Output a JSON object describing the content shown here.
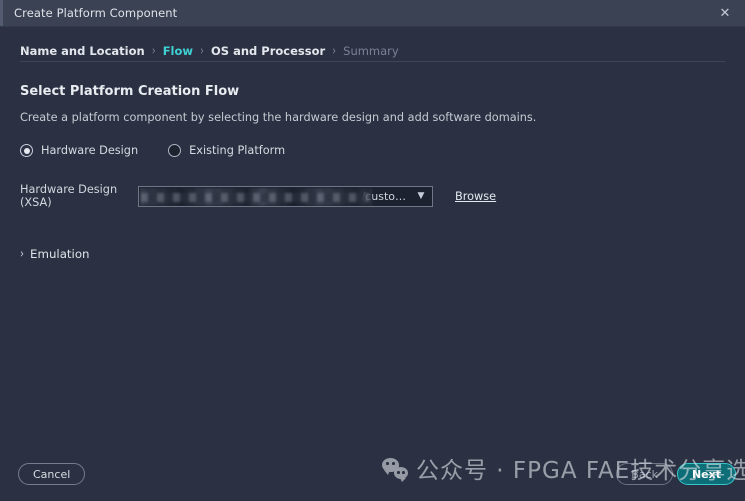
{
  "window": {
    "title": "Create Platform Component",
    "close_icon": "close-icon"
  },
  "breadcrumb": {
    "separator": "›",
    "items": [
      {
        "label": "Name and Location",
        "state": "done"
      },
      {
        "label": "Flow",
        "state": "active"
      },
      {
        "label": "OS and Processor",
        "state": "done"
      },
      {
        "label": "Summary",
        "state": "disabled"
      }
    ]
  },
  "main": {
    "section_title": "Select Platform Creation Flow",
    "section_desc": "Create a platform component by selecting the hardware design and add software domains.",
    "radios": [
      {
        "label": "Hardware Design",
        "selected": true
      },
      {
        "label": "Existing Platform",
        "selected": false
      }
    ],
    "field": {
      "label": "Hardware Design (XSA)",
      "value": "/custo…",
      "caret_icon": "chevron-down-icon",
      "browse_label": "Browse"
    },
    "expander": {
      "arrow_icon": "chevron-right-icon",
      "label": "Emulation",
      "expanded": false
    }
  },
  "footer": {
    "cancel_label": "Cancel",
    "back_label": "Back",
    "next_label": "Next"
  },
  "watermark": {
    "logo_icon": "wechat-icon",
    "text": "公众号 · FPGA FAE技术分享选集"
  },
  "colors": {
    "background": "#2b3142",
    "titlebar": "#3b4254",
    "accent": "#3fd0d4",
    "next_button_bg": "#0e6e78",
    "text_primary": "#e3e6ec",
    "text_muted": "#7b8296"
  }
}
